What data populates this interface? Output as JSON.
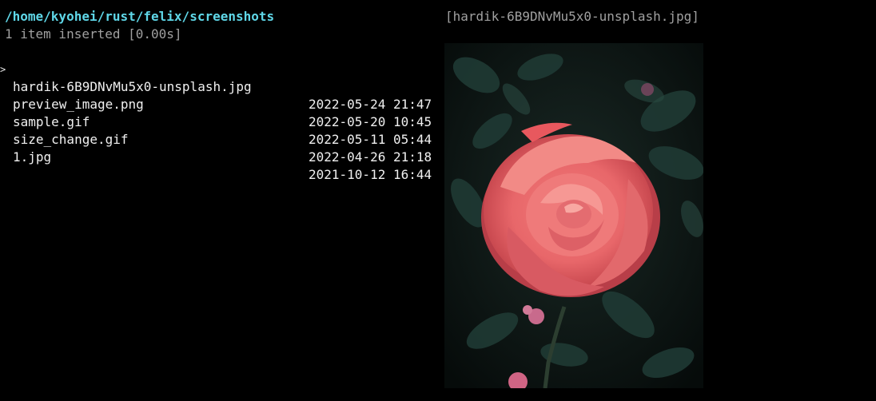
{
  "header": {
    "path": "/home/kyohei/rust/felix/screenshots",
    "status": "1 item inserted [0.00s]"
  },
  "files": [
    {
      "name": "hardik-6B9DNvMu5x0-unsplash.jpg",
      "date": "2022-05-24 21:47",
      "cursor": ">"
    },
    {
      "name": "preview_image.png",
      "date": "2022-05-20 10:45",
      "cursor": ""
    },
    {
      "name": "sample.gif",
      "date": "2022-05-11 05:44",
      "cursor": ""
    },
    {
      "name": "size_change.gif",
      "date": "2022-04-26 21:18",
      "cursor": ""
    },
    {
      "name": "1.jpg",
      "date": "2021-10-12 16:44",
      "cursor": ""
    }
  ],
  "preview": {
    "title": "[hardik-6B9DNvMu5x0-unsplash.jpg]"
  },
  "colors": {
    "path": "#5fd7e8",
    "status": "#a0a0a0",
    "background": "#000000"
  }
}
